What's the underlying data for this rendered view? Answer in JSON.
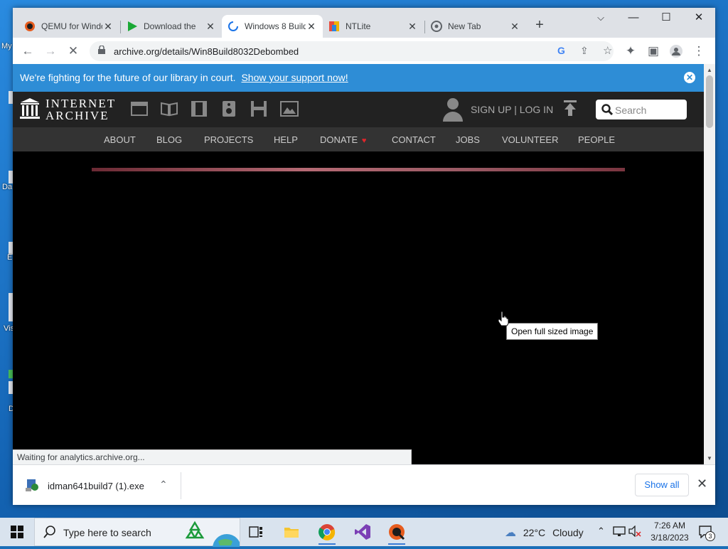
{
  "desktop": {
    "labels": [
      "My",
      "Da",
      "E",
      "Vis",
      "D"
    ]
  },
  "browser": {
    "tabs": [
      {
        "title": "QEMU for Windows",
        "active": false
      },
      {
        "title": "Download the",
        "active": false
      },
      {
        "title": "Windows 8 Build",
        "active": true
      },
      {
        "title": "NTLite",
        "active": false
      },
      {
        "title": "New Tab",
        "active": false
      }
    ],
    "new_tab_label": "+",
    "url": "archive.org/details/Win8Build8032Debombed",
    "status_text": "Waiting for analytics.archive.org..."
  },
  "page": {
    "banner": {
      "text": "We're fighting for the future of our library in court.",
      "link": "Show your support now!"
    },
    "header": {
      "logo_line1": "INTERNET",
      "logo_line2": "ARCHIVE",
      "signup": "SIGN UP | LOG IN",
      "search_placeholder": "Search"
    },
    "nav": [
      "ABOUT",
      "BLOG",
      "PROJECTS",
      "HELP",
      "DONATE",
      "CONTACT",
      "JOBS",
      "VOLUNTEER",
      "PEOPLE"
    ],
    "tooltip": "Open full sized image"
  },
  "downloads": {
    "file_name": "idman641build7 (1).exe",
    "show_all": "Show all"
  },
  "taskbar": {
    "search_placeholder": "Type here to search",
    "weather_temp": "22°C",
    "weather_desc": "Cloudy",
    "time": "7:26 AM",
    "date": "3/18/2023",
    "notification_count": "3"
  },
  "colors": {
    "banner_bg": "#2e8dd6",
    "header_bg": "#222222",
    "nav_bg": "#333333",
    "donate_heart": "#e0262b",
    "link_blue": "#1a73e8"
  }
}
